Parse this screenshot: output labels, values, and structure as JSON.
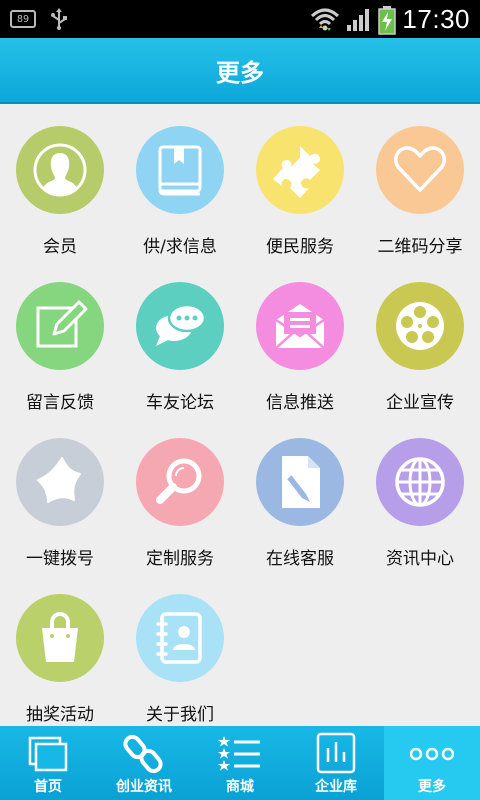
{
  "status_bar": {
    "battery_small": "89",
    "time": "17:30"
  },
  "header": {
    "title": "更多"
  },
  "grid": {
    "items": [
      {
        "label": "会员",
        "color": "#b6cc6a",
        "icon": "person-icon"
      },
      {
        "label": "供/求信息",
        "color": "#8fd4f2",
        "icon": "book-icon"
      },
      {
        "label": "便民服务",
        "color": "#f8e36f",
        "icon": "puzzle-icon"
      },
      {
        "label": "二维码分享",
        "color": "#f9c895",
        "icon": "heart-icon"
      },
      {
        "label": "留言反馈",
        "color": "#86d57f",
        "icon": "edit-icon"
      },
      {
        "label": "车友论坛",
        "color": "#5ccfc1",
        "icon": "chat-icon"
      },
      {
        "label": "信息推送",
        "color": "#f48ce0",
        "icon": "mail-icon"
      },
      {
        "label": "企业宣传",
        "color": "#c9c852",
        "icon": "film-reel-icon"
      },
      {
        "label": "一键拨号",
        "color": "#c7ced8",
        "icon": "star-icon"
      },
      {
        "label": "定制服务",
        "color": "#f6a8b2",
        "icon": "magnifier-icon"
      },
      {
        "label": "在线客服",
        "color": "#9bb8e3",
        "icon": "document-edit-icon"
      },
      {
        "label": "资讯中心",
        "color": "#b69ee9",
        "icon": "globe-icon"
      },
      {
        "label": "抽奖活动",
        "color": "#b9d06b",
        "icon": "bag-icon"
      },
      {
        "label": "关于我们",
        "color": "#a9e1f6",
        "icon": "contact-book-icon"
      }
    ]
  },
  "bottom_nav": {
    "items": [
      {
        "label": "首页",
        "icon": "pages-icon"
      },
      {
        "label": "创业资讯",
        "icon": "link-icon"
      },
      {
        "label": "商城",
        "icon": "star-list-icon"
      },
      {
        "label": "企业库",
        "icon": "bar-chart-icon"
      },
      {
        "label": "更多",
        "icon": "more-dots-icon"
      }
    ],
    "active_index": 4
  }
}
